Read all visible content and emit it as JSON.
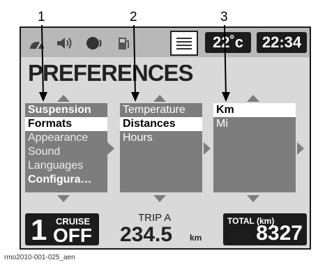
{
  "callouts": [
    "1",
    "2",
    "3"
  ],
  "status_bar": {
    "icons": [
      "gauge-icon",
      "speaker-icon",
      "phone-headset-icon",
      "fuel-pump-icon",
      "preferences-tab-icon"
    ],
    "temperature": "22˚c",
    "clock": "22:34"
  },
  "page_title": "PREFERENCES",
  "columns": {
    "menu": {
      "items": [
        "Suspension",
        "Formats",
        "Appearance",
        "Sound",
        "Languages",
        "Configura…"
      ],
      "selected": "Formats"
    },
    "submenu": {
      "items": [
        "Temperature",
        "Distances",
        "Hours"
      ],
      "selected": "Distances"
    },
    "options": {
      "items": [
        "Km",
        "Mi"
      ],
      "selected": "Km"
    }
  },
  "bottom_bar": {
    "cruise_number": "1",
    "cruise_label": "CRUISE",
    "cruise_state": "OFF",
    "trip_label": "TRIP A",
    "trip_value": "234.5",
    "trip_unit": "km",
    "total_label": "TOTAL (km)",
    "total_value": "8327"
  },
  "caption": "rmo2010-001-025_aen",
  "colors": {
    "screen_bg": "#d9d9d9",
    "panel_bg": "#7d7d7d",
    "dark_box": "#1c1c1c"
  }
}
